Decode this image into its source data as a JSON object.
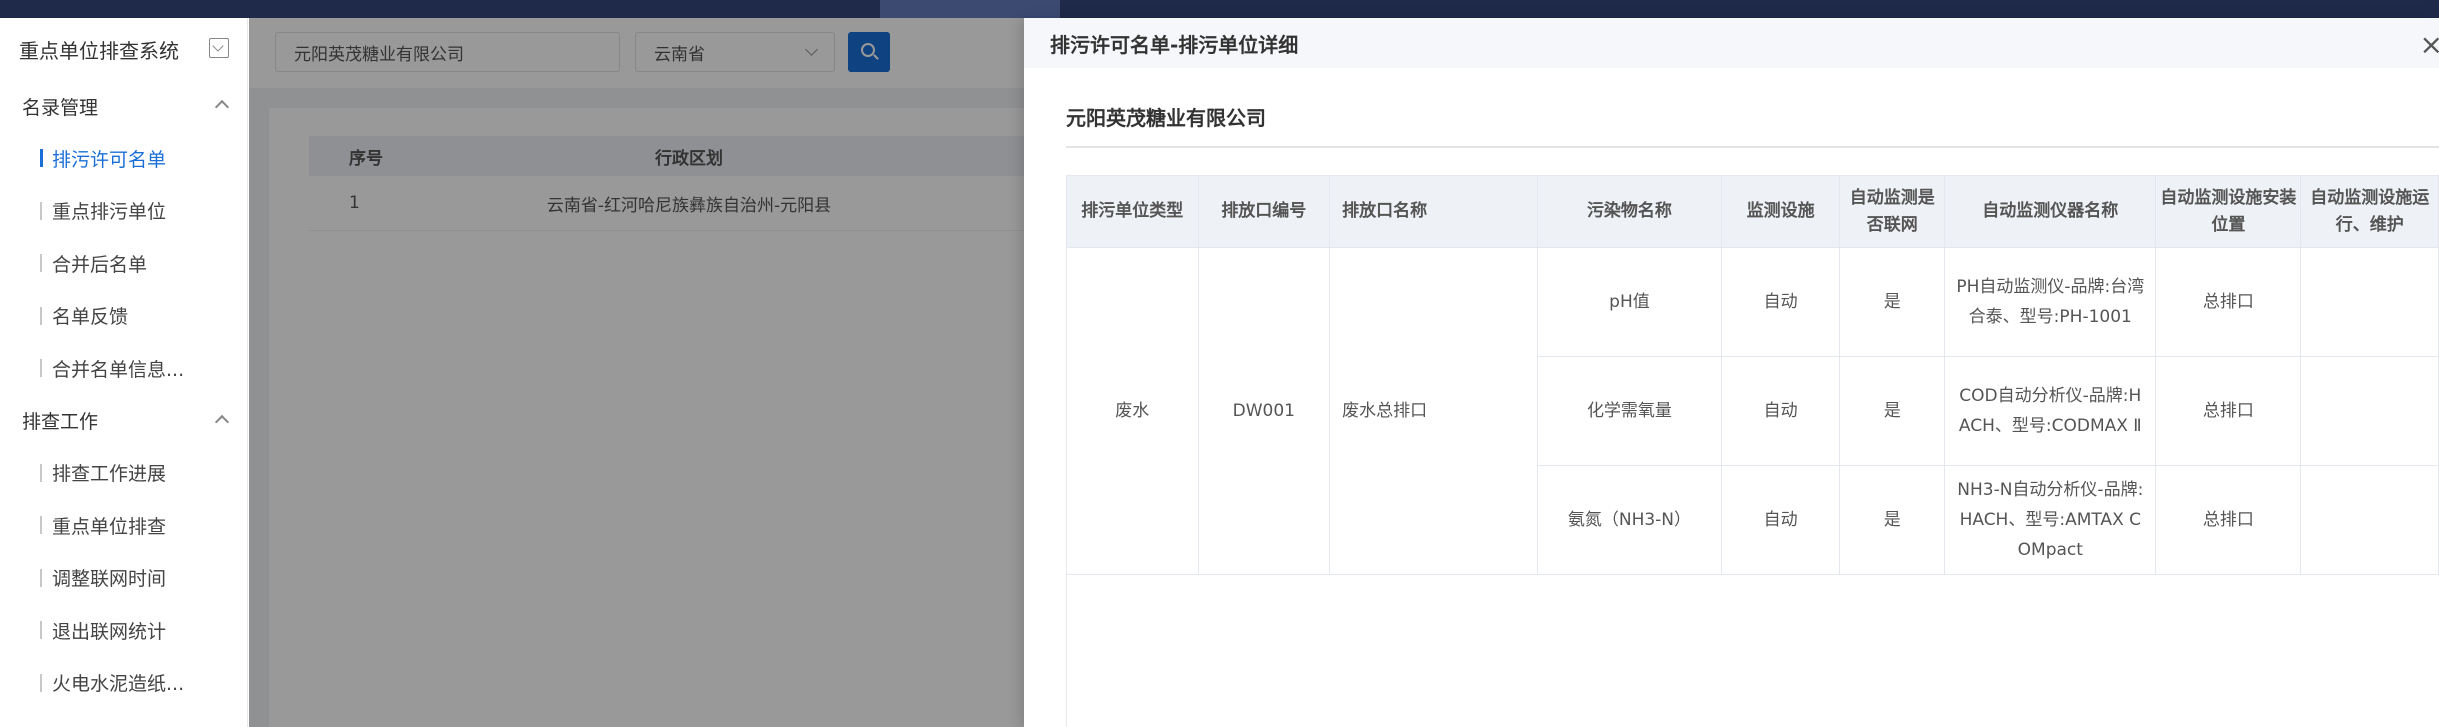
{
  "sidebar": {
    "title": "重点单位排查系统",
    "groups": [
      {
        "label": "名录管理",
        "items": [
          "排污许可名单",
          "重点排污单位",
          "合并后名单",
          "名单反馈",
          "合并名单信息..."
        ]
      },
      {
        "label": "排查工作",
        "items": [
          "排查工作进展",
          "重点单位排查",
          "调整联网时间",
          "退出联网统计",
          "火电水泥造纸..."
        ]
      }
    ],
    "active_item": "排污许可名单"
  },
  "search": {
    "company_value": "元阳英茂糖业有限公司",
    "province_value": "云南省"
  },
  "main_table": {
    "headers": [
      "序号",
      "行政区划"
    ],
    "rows": [
      {
        "seq": "1",
        "region": "云南省-红河哈尼族彝族自治州-元阳县"
      }
    ]
  },
  "drawer": {
    "title": "排污许可名单-排污单位详细",
    "close_symbol": "×",
    "company": "元阳英茂糖业有限公司",
    "headers": [
      "排污单位类型",
      "排放口编号",
      "排放口名称",
      "污染物名称",
      "监测设施",
      "自动监测是否联网",
      "自动监测仪器名称",
      "自动监测设施安装位置",
      "自动监测设施运行、维护"
    ],
    "outlet": {
      "type": "废水",
      "code": "DW001",
      "name": "废水总排口"
    },
    "rows": [
      {
        "pollutant": "pH值",
        "facility": "自动",
        "networked": "是",
        "instrument": "PH自动监测仪-品牌:台湾合泰、型号:PH-1001",
        "location": "总排口"
      },
      {
        "pollutant": "化学需氧量",
        "facility": "自动",
        "networked": "是",
        "instrument": "COD自动分析仪-品牌:HACH、型号:CODMAX Ⅱ",
        "location": "总排口"
      },
      {
        "pollutant": "氨氮（NH3-N）",
        "facility": "自动",
        "networked": "是",
        "instrument": "NH3-N自动分析仪-品牌:HACH、型号:AMTAX COMpact",
        "location": "总排口"
      }
    ]
  }
}
